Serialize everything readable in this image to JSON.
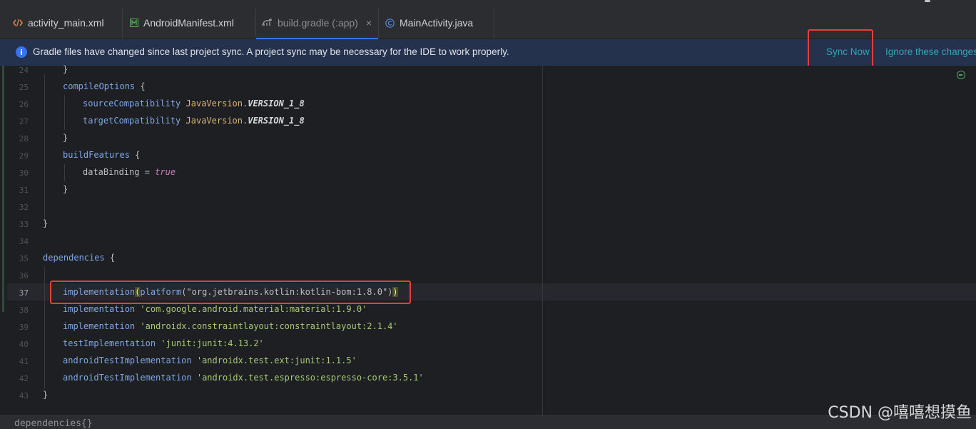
{
  "tabs": [
    {
      "label": "activity_main.xml",
      "icon": "xml-file-icon"
    },
    {
      "label": "AndroidManifest.xml",
      "icon": "manifest-file-icon"
    },
    {
      "label": "build.gradle (:app)",
      "icon": "gradle-file-icon",
      "active": true,
      "close": "×"
    },
    {
      "label": "MainActivity.java",
      "icon": "java-class-icon"
    }
  ],
  "banner": {
    "info_glyph": "i",
    "message": "Gradle files have changed since last project sync. A project sync may be necessary for the IDE to work properly.",
    "sync_now": "Sync Now",
    "ignore": "Ignore these changes"
  },
  "line_numbers": [
    "24",
    "25",
    "26",
    "27",
    "28",
    "29",
    "30",
    "31",
    "32",
    "33",
    "34",
    "35",
    "36",
    "37",
    "38",
    "39",
    "40",
    "41",
    "42",
    "43"
  ],
  "current_line": "37",
  "code": {
    "l24": "}",
    "l25_a": "compileOptions",
    "l25_b": " {",
    "l26_a": "sourceCompatibility",
    "l26_b": "JavaVersion",
    "l26_c": ".",
    "l26_d": "VERSION_1_8",
    "l27_a": "targetCompatibility",
    "l27_b": "JavaVersion",
    "l27_c": ".",
    "l27_d": "VERSION_1_8",
    "l28": "}",
    "l29_a": "buildFeatures",
    "l29_b": " {",
    "l30_a": "dataBinding",
    "l30_b": " = ",
    "l30_c": "true",
    "l31": "}",
    "l33": "}",
    "l35_a": "dependencies",
    "l35_b": " {",
    "l37_a": "implementation",
    "l37_b": "(",
    "l37_c": "platform",
    "l37_d": "(\"org.jetbrains.kotlin:kotlin-bom:1.8.0\")",
    "l37_e": ")",
    "l38_a": "implementation",
    "l38_b": "'com.google.android.material:material:1.9.0'",
    "l39_a": "implementation",
    "l39_b": "'androidx.constraintlayout:constraintlayout:2.1.4'",
    "l40_a": "testImplementation",
    "l40_b": "'junit:junit:4.13.2'",
    "l41_a": "androidTestImplementation",
    "l41_b": "'androidx.test.ext:junit:1.1.5'",
    "l42_a": "androidTestImplementation",
    "l42_b": "'androidx.test.espresso:espresso-core:3.5.1'",
    "l43": "}"
  },
  "status": {
    "breadcrumb": "dependencies{}"
  },
  "watermark": "CSDN @嘻嘻想摸鱼",
  "colors": {
    "accent": "#3574f0",
    "link": "#2fa5b5",
    "highlight_box": "#e0413a",
    "keyword": "#7fa7e6",
    "string": "#a8c976"
  }
}
